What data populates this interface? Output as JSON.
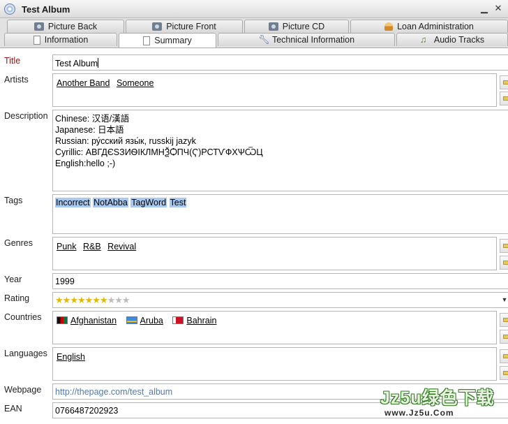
{
  "window": {
    "title": "Test Album",
    "minimize_glyph": "▁",
    "close_glyph": "✕"
  },
  "tabs_row_back": [
    {
      "label": "Picture Back",
      "icon": "camera-icon"
    },
    {
      "label": "Picture Front",
      "icon": "camera-icon"
    },
    {
      "label": "Picture CD",
      "icon": "camera-icon"
    },
    {
      "label": "Loan Administration",
      "icon": "person-icon"
    }
  ],
  "tabs_row_front": [
    {
      "label": "Information",
      "icon": "document-icon"
    },
    {
      "label": "Summary",
      "icon": "document-icon",
      "active": true
    },
    {
      "label": "Technical Information",
      "icon": "wrench-icon"
    },
    {
      "label": "Audio Tracks",
      "icon": "music-note-icon"
    }
  ],
  "fields": {
    "title": {
      "label": "Title",
      "value": "Test Album"
    },
    "artists": {
      "label": "Artists",
      "items": [
        "Another Band",
        "Someone"
      ]
    },
    "description": {
      "label": "Description",
      "lines": [
        "Chinese: 汉语/漢語",
        "Japanese: 日本語",
        "Russian: ру́сский язы́к, russkij jazyk",
        "Cyrillic: АВГДЄЅЗИѲІКЛМНѮѺПЧ(Ҁ)РСТѴФХѰѾЦ",
        "English:hello ;-)"
      ]
    },
    "tags": {
      "label": "Tags",
      "items": [
        "Incorrect",
        "NotAbba",
        "TagWord",
        "Test"
      ]
    },
    "genres": {
      "label": "Genres",
      "items": [
        "Punk",
        "R&B",
        "Revival"
      ]
    },
    "year": {
      "label": "Year",
      "value": "1999"
    },
    "rating": {
      "label": "Rating",
      "value": 7,
      "max": 10
    },
    "countries": {
      "label": "Countries",
      "items": [
        "Afghanistan",
        "Aruba",
        "Bahrain"
      ]
    },
    "languages": {
      "label": "Languages",
      "items": [
        "English"
      ]
    },
    "webpage": {
      "label": "Webpage",
      "value": "http://thepage.com/test_album"
    },
    "ean": {
      "label": "EAN",
      "value": "0766487202923"
    }
  },
  "watermark": {
    "line1": "Jz5u绿色下载",
    "line2": "www.Jz5u.Com"
  }
}
